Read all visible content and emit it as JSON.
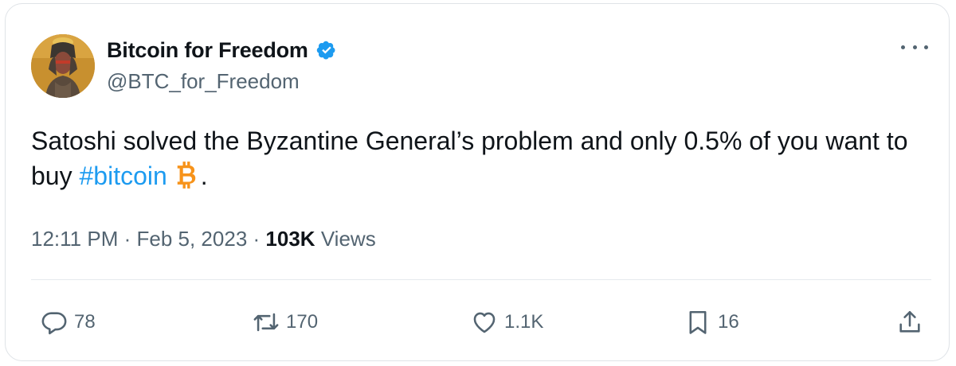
{
  "author": {
    "display_name": "Bitcoin for Freedom",
    "handle": "@BTC_for_Freedom",
    "verified": true,
    "avatar_icon": "avatar-figure-icon"
  },
  "tweet": {
    "text_before_hashtag": "Satoshi solved the Byzantine General’s problem and only 0.5% of you want to buy ",
    "hashtag": "#bitcoin",
    "text_after_emoji": ".",
    "emoji_icon": "bitcoin-icon"
  },
  "meta": {
    "time": "12:11 PM",
    "separator": "·",
    "date": "Feb 5, 2023",
    "views_count": "103K",
    "views_label": "Views"
  },
  "actions": {
    "replies": "78",
    "retweets": "170",
    "likes": "1.1K",
    "bookmarks": "16"
  },
  "colors": {
    "hashtag": "#1d9bf0",
    "secondary_text": "#536471",
    "verified_badge": "#1d9bf0",
    "bitcoin_orange": "#f7931a"
  }
}
